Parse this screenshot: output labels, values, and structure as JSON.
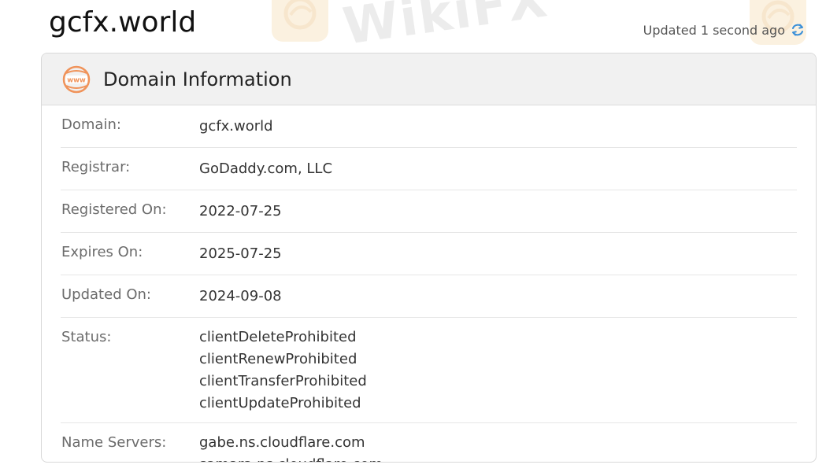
{
  "page": {
    "title": "gcfx.world",
    "updated_text": "Updated 1 second ago",
    "watermark_text": "WikiFX"
  },
  "card": {
    "title": "Domain Information",
    "icon": "www-globe-icon",
    "accent_color": "#f0935a"
  },
  "domain_info": {
    "domain": {
      "label": "Domain:",
      "value": "gcfx.world"
    },
    "registrar": {
      "label": "Registrar:",
      "value": "GoDaddy.com, LLC"
    },
    "registered_on": {
      "label": "Registered On:",
      "value": "2022-07-25"
    },
    "expires_on": {
      "label": "Expires On:",
      "value": "2025-07-25"
    },
    "updated_on": {
      "label": "Updated On:",
      "value": "2024-09-08"
    },
    "status": {
      "label": "Status:",
      "values": [
        "clientDeleteProhibited",
        "clientRenewProhibited",
        "clientTransferProhibited",
        "clientUpdateProhibited"
      ]
    },
    "name_servers": {
      "label": "Name Servers:",
      "values": [
        "gabe.ns.cloudflare.com",
        "samara.ns.cloudflare.com"
      ]
    }
  },
  "colors": {
    "refresh_icon": "#3a8fd8",
    "watermark_logo": "#f6d9a8"
  }
}
